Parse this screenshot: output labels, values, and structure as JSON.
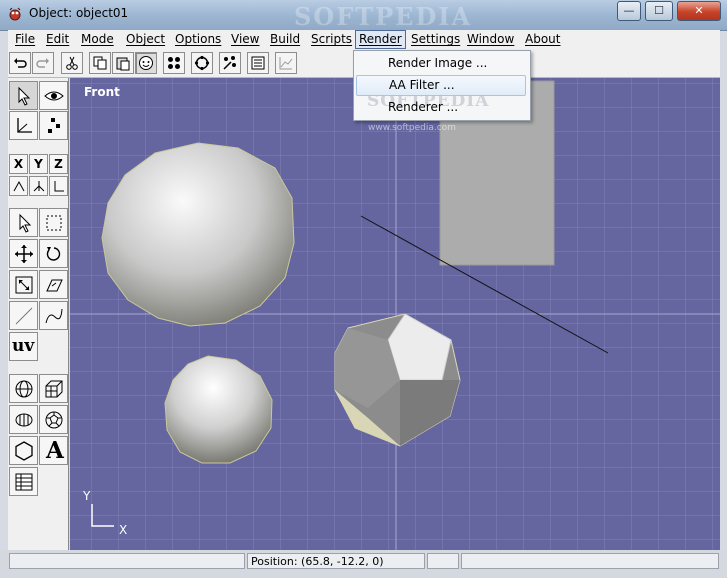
{
  "window": {
    "title": "Object: object01",
    "watermark": "SOFTPEDIA",
    "controls": {
      "minimize": "—",
      "maximize": "☐",
      "close": "✕"
    },
    "icon": "app-icon"
  },
  "menubar": {
    "items": [
      {
        "label": "File"
      },
      {
        "label": "Edit"
      },
      {
        "label": "Mode"
      },
      {
        "label": "Object"
      },
      {
        "label": "Options"
      },
      {
        "label": "View"
      },
      {
        "label": "Build"
      },
      {
        "label": "Scripts"
      },
      {
        "label": "Render"
      },
      {
        "label": "Settings"
      },
      {
        "label": "Window"
      },
      {
        "label": "About"
      }
    ],
    "open_menu": "Render"
  },
  "render_menu": {
    "items": [
      {
        "label": "Render Image ..."
      },
      {
        "label": "AA Filter ..."
      },
      {
        "label": "Renderer ..."
      }
    ],
    "highlighted": "AA Filter ...",
    "watermark": "SOFTPEDIA",
    "watermark_url": "www.softpedia.com"
  },
  "toolbar": {
    "buttons": [
      "undo-icon",
      "redo-icon",
      "cut-icon",
      "copy-icon",
      "paste-icon",
      "sphere-icon",
      "dots-icon",
      "circle-icon",
      "snap-icon",
      "list-icon",
      "graph-icon"
    ]
  },
  "sidepanel": {
    "axis_buttons": {
      "x": "X",
      "y": "Y",
      "z": "Z"
    },
    "uv_label": "uv",
    "text_tool_label": "A"
  },
  "viewport": {
    "label": "Front",
    "axis_y": "Y",
    "axis_x": "X",
    "background": "#6565a0",
    "grid_color": "#8484b8"
  },
  "statusbar": {
    "position": "Position: (65.8, -12.2, 0)"
  }
}
